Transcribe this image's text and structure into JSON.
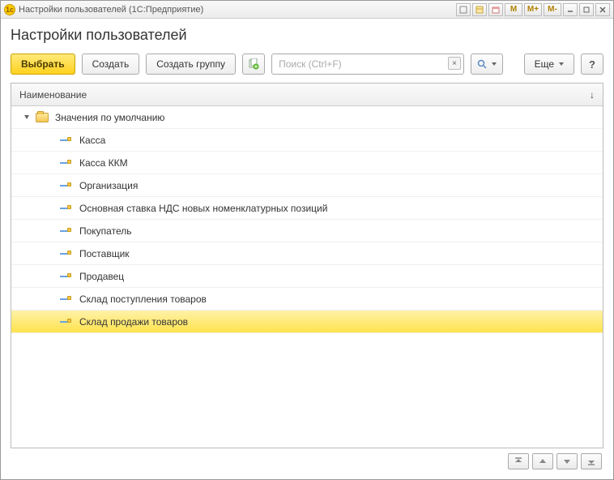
{
  "titlebar": {
    "title": "Настройки пользователей  (1С:Предприятие)",
    "tools": {
      "m": "M",
      "mplus": "M+",
      "mminus": "M-"
    }
  },
  "page": {
    "title": "Настройки пользователей"
  },
  "toolbar": {
    "select": "Выбрать",
    "create": "Создать",
    "create_group": "Создать группу",
    "search_placeholder": "Поиск (Ctrl+F)",
    "more": "Еще",
    "help": "?"
  },
  "grid": {
    "column": "Наименование",
    "group": {
      "label": "Значения по умолчанию"
    },
    "items": [
      {
        "label": "Касса"
      },
      {
        "label": "Касса ККМ"
      },
      {
        "label": "Организация"
      },
      {
        "label": "Основная ставка НДС новых номенклатурных позиций"
      },
      {
        "label": "Покупатель"
      },
      {
        "label": "Поставщик"
      },
      {
        "label": "Продавец"
      },
      {
        "label": "Склад поступления товаров"
      },
      {
        "label": "Склад продажи товаров",
        "selected": true
      }
    ]
  }
}
